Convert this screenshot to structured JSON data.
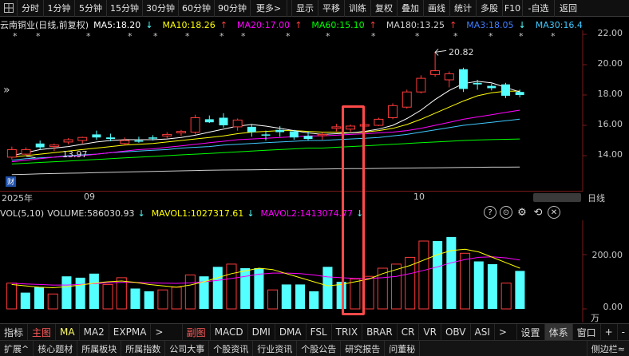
{
  "toolbar": {
    "items": [
      "分时",
      "1分钟",
      "5分钟",
      "15分钟",
      "30分钟",
      "60分钟",
      "90分钟",
      "更多>",
      "显示",
      "平移",
      "训练",
      "复权",
      "叠加",
      "画线",
      "统计",
      "多股",
      "F10",
      "-自选",
      "返回"
    ]
  },
  "info": {
    "stock": "云南铜业(日线,前复权)",
    "ma5": "MA5:18.20",
    "ma5_arrow": "↓",
    "ma10": "MA10:18.26",
    "ma10_arrow": "↑",
    "ma20": "MA20:17.00",
    "ma20_arrow": "↑",
    "ma60": "MA60:15.10",
    "ma60_arrow": "↑",
    "ma180": "MA180:13.25",
    "ma180_arrow": "↑",
    "ma3": "MA3:18.05",
    "ma3_arrow": "↓",
    "ma30": "MA30:16.41",
    "ma30_arrow": "↑"
  },
  "colors": {
    "up": "#ff3b3b",
    "down": "#54ffff",
    "ma5": "#ffffff",
    "ma10": "#ffff00",
    "ma20": "#ff00ff",
    "ma60": "#00ff00",
    "ma180": "#d0d0d0",
    "ma3": "#3f7fff",
    "ma30": "#40c8ff",
    "highlight": "#ff4040"
  },
  "price_axis": [
    "22.00",
    "20.00",
    "18.00",
    "16.00",
    "14.00"
  ],
  "date_axis": [
    "2025年",
    "09",
    "10"
  ],
  "annotations": {
    "high_label": "20.82",
    "low_label": "13.97",
    "cai_badge": "财",
    "period_label": "日线",
    "chevron": "»",
    "star": "*"
  },
  "chart_data": {
    "type": "bar",
    "title": "云南铜业(日线,前复权)",
    "candles": [
      {
        "o": 13.9,
        "h": 14.6,
        "l": 13.75,
        "c": 14.4
      },
      {
        "o": 14.1,
        "h": 14.55,
        "l": 13.97,
        "c": 14.4
      },
      {
        "o": 14.8,
        "h": 15.0,
        "l": 14.4,
        "c": 14.55
      },
      {
        "o": 14.6,
        "h": 14.8,
        "l": 14.3,
        "c": 14.7
      },
      {
        "o": 14.9,
        "h": 15.15,
        "l": 14.75,
        "c": 15.05
      },
      {
        "o": 15.0,
        "h": 15.25,
        "l": 14.8,
        "c": 15.2
      },
      {
        "o": 15.4,
        "h": 15.65,
        "l": 15.05,
        "c": 15.2
      },
      {
        "o": 15.2,
        "h": 15.45,
        "l": 14.95,
        "c": 15.1
      },
      {
        "o": 14.8,
        "h": 15.2,
        "l": 14.7,
        "c": 15.0
      },
      {
        "o": 15.0,
        "h": 15.25,
        "l": 14.85,
        "c": 14.95
      },
      {
        "o": 15.2,
        "h": 15.35,
        "l": 15.0,
        "c": 15.15
      },
      {
        "o": 15.3,
        "h": 15.55,
        "l": 15.15,
        "c": 15.4
      },
      {
        "o": 15.5,
        "h": 15.7,
        "l": 15.3,
        "c": 15.6
      },
      {
        "o": 15.55,
        "h": 16.7,
        "l": 15.4,
        "c": 16.5
      },
      {
        "o": 16.4,
        "h": 16.65,
        "l": 16.15,
        "c": 16.2
      },
      {
        "o": 16.5,
        "h": 16.8,
        "l": 15.85,
        "c": 16.0
      },
      {
        "o": 15.9,
        "h": 16.45,
        "l": 15.65,
        "c": 16.35
      },
      {
        "o": 15.9,
        "h": 16.1,
        "l": 15.25,
        "c": 15.55
      },
      {
        "o": 15.4,
        "h": 15.65,
        "l": 15.0,
        "c": 15.35
      },
      {
        "o": 15.7,
        "h": 15.95,
        "l": 15.25,
        "c": 15.55
      },
      {
        "o": 15.6,
        "h": 15.7,
        "l": 15.05,
        "c": 15.2
      },
      {
        "o": 15.3,
        "h": 15.6,
        "l": 15.0,
        "c": 15.1
      },
      {
        "o": 15.35,
        "h": 15.55,
        "l": 15.05,
        "c": 15.4
      },
      {
        "o": 15.8,
        "h": 16.1,
        "l": 15.6,
        "c": 15.9
      },
      {
        "o": 15.75,
        "h": 16.05,
        "l": 15.55,
        "c": 15.95
      },
      {
        "o": 15.95,
        "h": 16.25,
        "l": 15.85,
        "c": 16.05
      },
      {
        "o": 16.0,
        "h": 16.5,
        "l": 15.95,
        "c": 16.4
      },
      {
        "o": 16.5,
        "h": 17.45,
        "l": 16.4,
        "c": 17.3
      },
      {
        "o": 17.2,
        "h": 18.35,
        "l": 17.1,
        "c": 18.2
      },
      {
        "o": 18.2,
        "h": 19.3,
        "l": 18.1,
        "c": 19.1
      },
      {
        "o": 19.35,
        "h": 20.82,
        "l": 19.2,
        "c": 19.6
      },
      {
        "o": 19.0,
        "h": 19.55,
        "l": 18.5,
        "c": 19.4
      },
      {
        "o": 19.7,
        "h": 19.8,
        "l": 18.2,
        "c": 18.4
      },
      {
        "o": 18.8,
        "h": 19.0,
        "l": 18.35,
        "c": 18.7
      },
      {
        "o": 18.6,
        "h": 18.75,
        "l": 18.3,
        "c": 18.45
      },
      {
        "o": 18.7,
        "h": 18.8,
        "l": 17.8,
        "c": 17.95
      },
      {
        "o": 18.2,
        "h": 18.35,
        "l": 17.85,
        "c": 18.0
      }
    ],
    "ma_lines": {
      "ma5": [
        14.0,
        14.2,
        14.4,
        14.5,
        14.6,
        14.75,
        14.9,
        15.0,
        15.05,
        15.05,
        15.05,
        15.1,
        15.2,
        15.35,
        15.55,
        15.75,
        15.95,
        16.05,
        15.95,
        15.8,
        15.65,
        15.5,
        15.4,
        15.45,
        15.5,
        15.6,
        15.75,
        16.0,
        16.45,
        17.0,
        17.7,
        18.3,
        18.75,
        18.9,
        18.8,
        18.5,
        18.2
      ],
      "ma10": [
        13.9,
        14.0,
        14.1,
        14.2,
        14.3,
        14.4,
        14.5,
        14.6,
        14.7,
        14.75,
        14.8,
        14.9,
        15.0,
        15.1,
        15.2,
        15.3,
        15.45,
        15.55,
        15.6,
        15.65,
        15.65,
        15.6,
        15.55,
        15.55,
        15.5,
        15.55,
        15.65,
        15.8,
        16.05,
        16.4,
        16.8,
        17.2,
        17.6,
        17.95,
        18.15,
        18.25,
        18.26
      ],
      "ma20": [
        13.6,
        13.7,
        13.8,
        13.9,
        13.95,
        14.0,
        14.1,
        14.2,
        14.3,
        14.4,
        14.45,
        14.55,
        14.65,
        14.75,
        14.85,
        14.95,
        15.05,
        15.1,
        15.15,
        15.2,
        15.25,
        15.3,
        15.3,
        15.35,
        15.4,
        15.45,
        15.5,
        15.55,
        15.65,
        15.8,
        16.0,
        16.2,
        16.4,
        16.55,
        16.7,
        16.85,
        17.0
      ],
      "ma30": [
        13.7,
        13.8,
        13.85,
        13.9,
        14.0,
        14.05,
        14.1,
        14.2,
        14.25,
        14.3,
        14.35,
        14.4,
        14.5,
        14.55,
        14.6,
        14.7,
        14.75,
        14.8,
        14.85,
        14.9,
        14.95,
        15.0,
        15.0,
        15.05,
        15.1,
        15.15,
        15.2,
        15.3,
        15.4,
        15.55,
        15.7,
        15.85,
        16.0,
        16.1,
        16.2,
        16.3,
        16.41
      ],
      "ma60": [
        13.45,
        13.5,
        13.55,
        13.6,
        13.65,
        13.7,
        13.75,
        13.8,
        13.85,
        13.9,
        13.95,
        14.0,
        14.05,
        14.1,
        14.15,
        14.2,
        14.25,
        14.3,
        14.35,
        14.4,
        14.45,
        14.5,
        14.5,
        14.55,
        14.6,
        14.65,
        14.7,
        14.75,
        14.8,
        14.85,
        14.9,
        14.95,
        15.0,
        15.03,
        15.06,
        15.08,
        15.1
      ],
      "ma180": [
        12.75,
        12.77,
        12.8,
        12.82,
        12.84,
        12.86,
        12.88,
        12.9,
        12.92,
        12.94,
        12.96,
        12.98,
        13.0,
        13.02,
        13.04,
        13.05,
        13.06,
        13.07,
        13.08,
        13.09,
        13.1,
        13.11,
        13.12,
        13.13,
        13.14,
        13.15,
        13.16,
        13.17,
        13.18,
        13.19,
        13.2,
        13.21,
        13.22,
        13.23,
        13.24,
        13.24,
        13.25
      ]
    },
    "ylim": [
      12.5,
      22.5
    ],
    "highlight_index": 23
  },
  "volume": {
    "label": "VOL(5,10)",
    "volume": "VOLUME:586030.93",
    "volume_arrow": "↓",
    "mavol1": "MAVOL1:1027317.61",
    "mavol1_arrow": "↓",
    "mavol2": "MAVOL2:1413074.77",
    "mavol2_arrow": "↓",
    "axis": [
      "200.00",
      "0.00"
    ],
    "unit": "万",
    "bars": [
      95,
      60,
      80,
      55,
      120,
      115,
      130,
      90,
      115,
      75,
      65,
      70,
      80,
      125,
      120,
      155,
      165,
      150,
      150,
      70,
      90,
      90,
      65,
      155,
      100,
      110,
      120,
      150,
      165,
      190,
      250,
      250,
      265,
      205,
      175,
      165,
      95,
      140
    ],
    "bars_up": [
      true,
      false,
      false,
      true,
      false,
      false,
      false,
      true,
      true,
      false,
      false,
      true,
      true,
      true,
      false,
      false,
      true,
      false,
      false,
      true,
      false,
      false,
      false,
      false,
      false,
      true,
      true,
      true,
      true,
      true,
      true,
      false,
      false,
      true,
      false,
      false,
      true,
      false
    ],
    "ma5": [
      90,
      85,
      80,
      78,
      82,
      88,
      95,
      100,
      103,
      98,
      90,
      85,
      80,
      88,
      100,
      115,
      130,
      140,
      150,
      145,
      130,
      115,
      100,
      85,
      90,
      100,
      110,
      130,
      145,
      160,
      180,
      200,
      215,
      220,
      210,
      190,
      170,
      150
    ],
    "ma10": [
      95,
      92,
      90,
      88,
      88,
      90,
      93,
      96,
      98,
      98,
      96,
      95,
      94,
      96,
      100,
      105,
      112,
      120,
      128,
      132,
      132,
      130,
      125,
      118,
      115,
      112,
      112,
      115,
      120,
      130,
      142,
      155,
      170,
      182,
      190,
      192,
      188,
      180
    ],
    "ylim": [
      0,
      280
    ]
  },
  "vol_tools": [
    "?",
    "⊙",
    "⚙",
    "⟲",
    "✕"
  ],
  "tabs1": [
    "指标",
    "主图",
    "MA",
    "MA2",
    "EXPMA",
    ">",
    "副图",
    "MACD",
    "DMI",
    "DMA",
    "FSL",
    "TRIX",
    "BRAR",
    "CR",
    "VR",
    "OBV",
    "ASI",
    ">",
    "设置",
    "体系",
    "窗口",
    "+",
    "-"
  ],
  "tabs2": [
    "扩展^",
    "核心题材",
    "所属板块",
    "所属指数",
    "公司大事",
    "个股资讯",
    "行业资讯",
    "个股公告",
    "研究报告",
    "问董秘",
    "侧边栏≈"
  ]
}
